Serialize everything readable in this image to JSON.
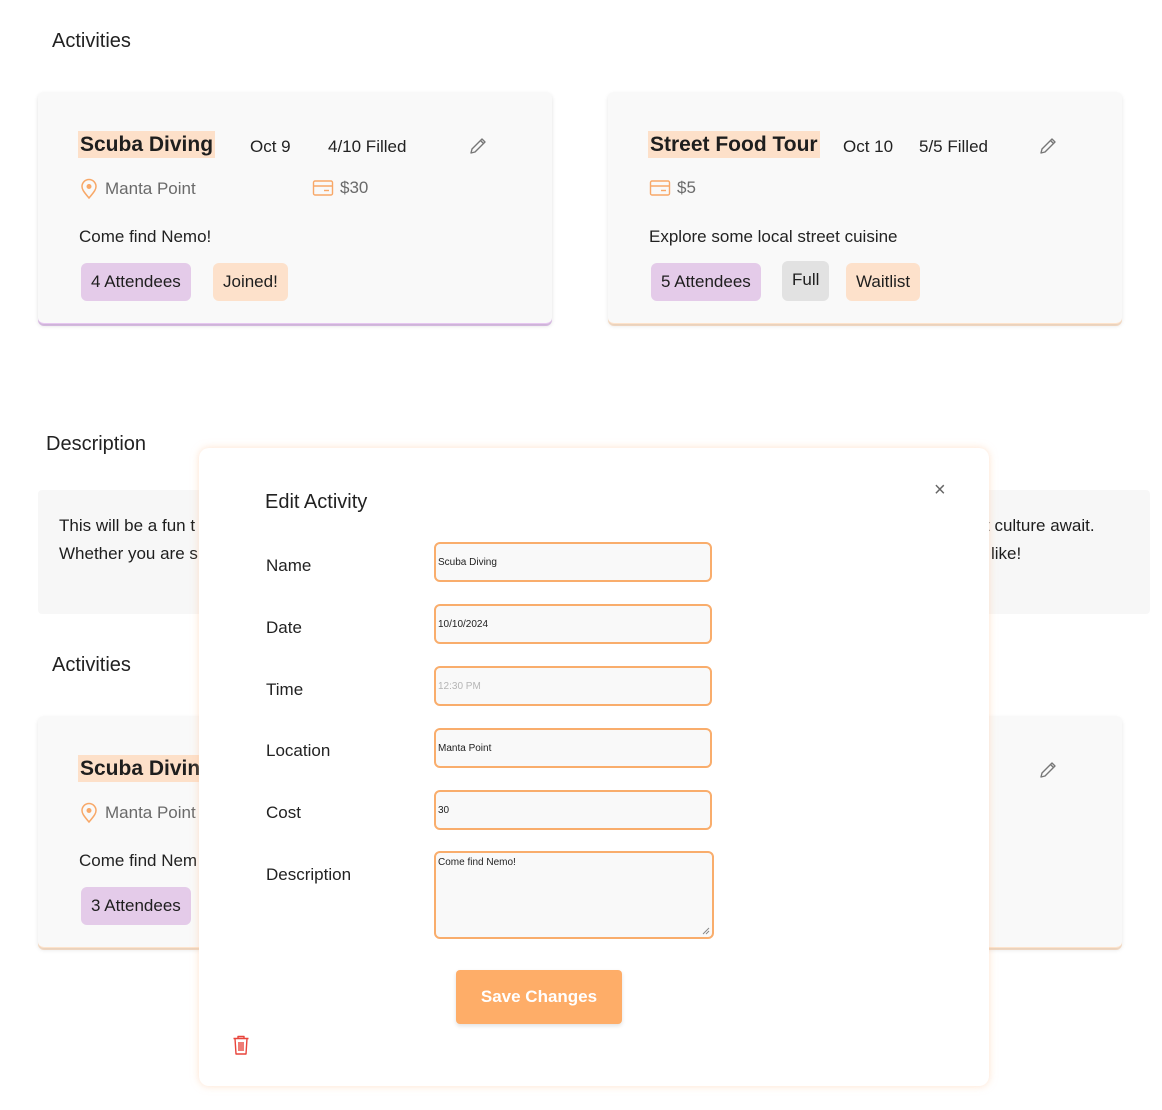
{
  "sections": {
    "activities_top": "Activities",
    "description": "Description",
    "activities_bottom": "Activities"
  },
  "cards_top": [
    {
      "title": "Scuba Diving",
      "date": "Oct 9",
      "filled": "4/10 Filled",
      "location": "Manta Point",
      "cost": "$30",
      "description": "Come find Nemo!",
      "attendees": "4 Attendees",
      "status": "Joined!"
    },
    {
      "title": "Street Food Tour",
      "date": "Oct 10",
      "filled": "5/5 Filled",
      "cost": "$5",
      "description": "Explore some local street cuisine",
      "attendees": "5 Attendees",
      "full": "Full",
      "waitlist": "Waitlist"
    }
  ],
  "description_panel": {
    "line1_left": "This will be a fun t",
    "line1_right": "t culture await.",
    "line2_left": "Whether you are s",
    "line2_right": "like!"
  },
  "card_bottom": {
    "title": "Scuba Divin",
    "location": "Manta Point",
    "description": "Come find Nem",
    "attendees": "3 Attendees"
  },
  "modal": {
    "title": "Edit Activity",
    "close": "×",
    "fields": {
      "name": {
        "label": "Name",
        "value": "Scuba Diving"
      },
      "date": {
        "label": "Date",
        "value": "10/10/2024"
      },
      "time": {
        "label": "Time",
        "placeholder": "12:30 PM"
      },
      "location": {
        "label": "Location",
        "value": "Manta Point"
      },
      "cost": {
        "label": "Cost",
        "value": "30"
      },
      "description": {
        "label": "Description",
        "value": "Come find Nemo!"
      }
    },
    "save_label": "Save Changes"
  },
  "colors": {
    "accent": "#fead68",
    "title_highlight": "#fde0c9",
    "chip_purple": "#e4cbe9",
    "chip_peach": "#fde1cb",
    "chip_gray": "#e2e2e2",
    "delete_red": "#e8453c"
  }
}
